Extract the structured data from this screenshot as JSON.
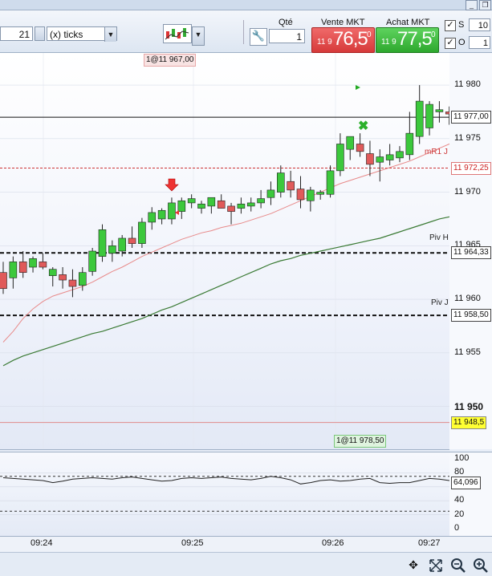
{
  "window": {
    "minimize_label": "_",
    "restore_label": "❐"
  },
  "toolbar": {
    "period_value": "21",
    "period_unit": "(x) ticks",
    "qty_header": "Qté",
    "qty_value": "1",
    "sell_header": "Vente MKT",
    "buy_header": "Achat MKT",
    "sell_price_small": "11 9",
    "sell_price_big": "76,5",
    "sell_price_sup": "0",
    "buy_price_small": "11 9",
    "buy_price_big": "77,5",
    "buy_price_sup": "0",
    "s_label": "S",
    "s_value": "10",
    "o_label": "O",
    "o_value": "1",
    "s_checked": "✓",
    "o_checked": "✓"
  },
  "chart": {
    "top_order_tag": "1@11 967,00",
    "bottom_order_tag": "1@11 978,50",
    "level_labels": {
      "mr1": "mR1 J",
      "pivh": "Piv H",
      "pivj": "Piv J"
    },
    "price_ticks": [
      "11 980",
      "11 975",
      "11 970",
      "11 965",
      "11 960",
      "11 955",
      "11 950"
    ],
    "price_tags": {
      "last": "11 977,00",
      "mr1": "11 972,25",
      "pivh": "11 964,33",
      "pivj": "11 958,50",
      "low": "11 948,5"
    },
    "colors": {
      "up": "#3cc83c",
      "down": "#e05a5a",
      "ma_fast": "#e88a8a",
      "ma_slow": "#3a7a34"
    }
  },
  "oscillator": {
    "ticks": [
      "100",
      "80",
      "60",
      "40",
      "20",
      "0"
    ],
    "value_tag": "64,096"
  },
  "time_axis": {
    "labels": [
      "09:24",
      "09:25",
      "09:26",
      "09:27"
    ]
  },
  "chart_data": {
    "type": "candlestick",
    "candles": [
      [
        11962.5,
        11963.5,
        11960.5,
        11961
      ],
      [
        11962,
        11964,
        11961,
        11963.5
      ],
      [
        11963.5,
        11964.5,
        11962,
        11962.5
      ],
      [
        11963,
        11964,
        11962.5,
        11963.8
      ],
      [
        11963.5,
        11964.3,
        11962.8,
        11963
      ],
      [
        11962.2,
        11963,
        11961.2,
        11962.8
      ],
      [
        11962.3,
        11963,
        11961,
        11961.8
      ],
      [
        11961.8,
        11962.8,
        11960.2,
        11961.2
      ],
      [
        11961.3,
        11963,
        11960.8,
        11962.5
      ],
      [
        11962.6,
        11964.8,
        11962.2,
        11964.5
      ],
      [
        11964,
        11967,
        11963.5,
        11966.5
      ],
      [
        11964.3,
        11965.5,
        11963.5,
        11965
      ],
      [
        11964.5,
        11966,
        11964,
        11965.7
      ],
      [
        11965.7,
        11966.8,
        11964.8,
        11965.2
      ],
      [
        11965.2,
        11967.6,
        11964.8,
        11967.2
      ],
      [
        11967.2,
        11968.6,
        11966.5,
        11968.1
      ],
      [
        11967.5,
        11968.5,
        11967,
        11968.3
      ],
      [
        11967.5,
        11969.5,
        11967,
        11969
      ],
      [
        11968.2,
        11969.5,
        11967.5,
        11969.2
      ],
      [
        11969,
        11969.8,
        11968.5,
        11969.4
      ],
      [
        11968.5,
        11969.2,
        11968,
        11968.9
      ],
      [
        11968.7,
        11969.3,
        11968,
        11969.5
      ],
      [
        11969.2,
        11969.8,
        11968.5,
        11968.5
      ],
      [
        11968.7,
        11969,
        11967,
        11968.2
      ],
      [
        11968.5,
        11969.5,
        11968,
        11968.9
      ],
      [
        11968.7,
        11969.5,
        11968.2,
        11969
      ],
      [
        11969,
        11970.2,
        11968.5,
        11969.4
      ],
      [
        11969.5,
        11971,
        11968.8,
        11970.2
      ],
      [
        11970,
        11972.5,
        11969.5,
        11971.8
      ],
      [
        11971,
        11972,
        11969.5,
        11970.2
      ],
      [
        11970.3,
        11971.5,
        11968.5,
        11969.3
      ],
      [
        11969.2,
        11970.5,
        11968.2,
        11970.2
      ],
      [
        11969.8,
        11970.2,
        11969.3,
        11970
      ],
      [
        11969.8,
        11972.5,
        11969.5,
        11972
      ],
      [
        11972,
        11975.5,
        11971.5,
        11974.5
      ],
      [
        11974,
        11975,
        11973,
        11975.2
      ],
      [
        11974.5,
        11975.5,
        11973.3,
        11973.8
      ],
      [
        11973.6,
        11974.8,
        11971.5,
        11972.6
      ],
      [
        11972.8,
        11974,
        11971,
        11973.3
      ],
      [
        11973,
        11974.5,
        11972.5,
        11973.5
      ],
      [
        11973.2,
        11974.3,
        11972.8,
        11973.8
      ],
      [
        11973.5,
        11977.5,
        11973,
        11975.5
      ],
      [
        11975.2,
        11980,
        11974.5,
        11978.5
      ],
      [
        11976,
        11978.5,
        11975.3,
        11978.2
      ],
      [
        11977.5,
        11978.5,
        11976.5,
        11977.7
      ],
      [
        11977.5,
        11978,
        11976.3,
        11977.3
      ],
      [
        11977.5,
        11978.2,
        11976.2,
        11976.5
      ],
      [
        11977,
        11977.8,
        11975.8,
        11976.8
      ],
      [
        11976.8,
        11977.6,
        11976.2,
        11977.2
      ],
      [
        11977,
        11977.6,
        11976.8,
        11977.5
      ]
    ],
    "ma_fast": [
      11956,
      11957,
      11958.2,
      11959.1,
      11959.8,
      11960.3,
      11960.6,
      11960.9,
      11961.2,
      11961.6,
      11962.1,
      11962.6,
      11963,
      11963.5,
      11964,
      11964.4,
      11964.8,
      11965.2,
      11965.6,
      11965.9,
      11966.2,
      11966.4,
      11966.7,
      11966.9,
      11967.1,
      11967.4,
      11967.7,
      11968,
      11968.4,
      11968.8,
      11969.2,
      11969.6,
      11970,
      11970.4,
      11970.8,
      11971.1,
      11971.4,
      11971.7,
      11972,
      11972.3,
      11972.6,
      11972.9,
      11973.3,
      11973.7,
      11974.1,
      11974.5,
      11974.8,
      11975,
      11975.2,
      11975.5
    ],
    "ma_slow": [
      11953.8,
      11954.3,
      11954.7,
      11955,
      11955.3,
      11955.6,
      11955.9,
      11956.2,
      11956.5,
      11956.8,
      11957,
      11957.3,
      11957.6,
      11957.9,
      11958.2,
      11958.6,
      11959,
      11959.3,
      11959.7,
      11960.1,
      11960.5,
      11960.9,
      11961.3,
      11961.7,
      11962.1,
      11962.5,
      11962.9,
      11963.3,
      11963.6,
      11963.8,
      11964.1,
      11964.3,
      11964.5,
      11964.7,
      11964.9,
      11965.1,
      11965.3,
      11965.5,
      11965.7,
      11966,
      11966.3,
      11966.6,
      11966.9,
      11967.2,
      11967.5,
      11967.7,
      11967.9,
      11968.1,
      11968.3,
      11968.5
    ],
    "levels": {
      "last": 11977,
      "mr1": 11972.25,
      "pivh": 11964.33,
      "pivj": 11958.5,
      "low": 11948.5
    },
    "ylim": [
      11946,
      11983
    ],
    "oscillator": [
      73,
      72,
      71,
      70,
      69,
      66,
      68,
      71,
      72,
      73,
      72,
      71,
      73,
      74,
      72,
      70,
      68,
      69,
      72,
      73,
      72,
      73,
      74,
      72,
      71,
      70,
      72,
      75,
      73,
      70,
      64,
      66,
      69,
      70,
      68,
      69,
      71,
      72,
      66,
      65,
      66,
      66,
      69,
      72,
      71,
      69,
      68,
      66,
      65,
      65
    ],
    "osc_ylim": [
      0,
      100
    ],
    "osc_lines": [
      75,
      25
    ]
  }
}
